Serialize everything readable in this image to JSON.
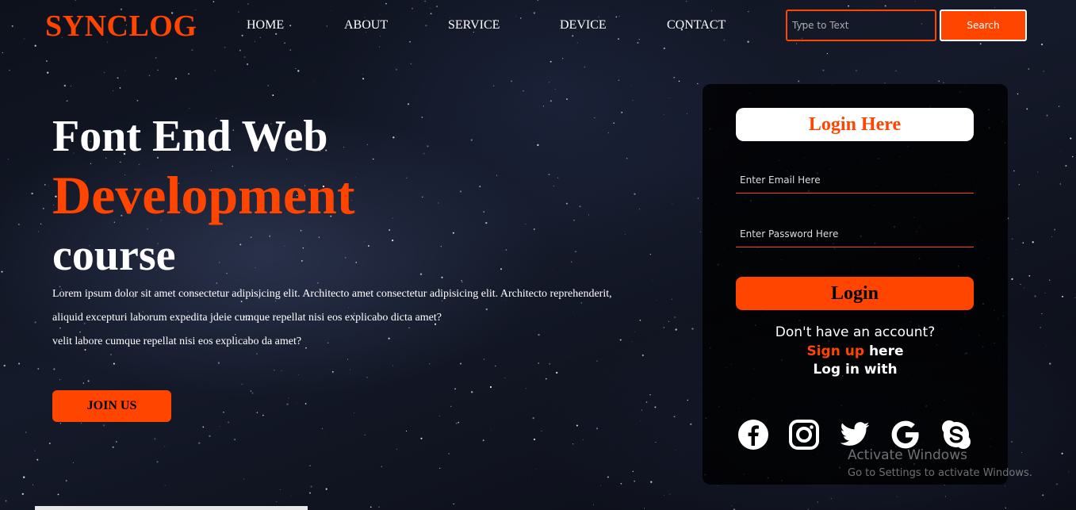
{
  "brand": {
    "logo": "SYNCLOG",
    "accent_color": "#ff4500"
  },
  "nav": {
    "items": [
      "HOME",
      "ABOUT",
      "SERVICE",
      "DEVICE",
      "CONTACT"
    ],
    "search_placeholder": "Type to Text",
    "search_button": "Search"
  },
  "hero": {
    "line1": "Font End Web",
    "line2": "Development",
    "line3": "course",
    "paragraph": [
      "Lorem ipsum dolor sit amet consectetur adipisicing elit. Architecto amet consectetur adipisicing elit. Architecto reprehenderit,",
      "aliquid excepturi laborum expedita jdeie cumque repellat nisi eos explicabo dicta amet?",
      "velit labore cumque repellat nisi eos explicabo da amet?"
    ],
    "join_button": "JOIN US"
  },
  "login": {
    "title": "Login Here",
    "email_placeholder": "Enter Email Here",
    "password_placeholder": "Enter Password Here",
    "button": "Login",
    "no_account": "Don't have an account?",
    "signup_link": "Sign up",
    "signup_suffix": " here",
    "login_with": "Log in with",
    "socials": [
      "facebook-icon",
      "instagram-icon",
      "twitter-icon",
      "google-icon",
      "skype-icon"
    ]
  },
  "watermark": {
    "title": "Activate Windows",
    "subtitle": "Go to Settings to activate Windows."
  }
}
